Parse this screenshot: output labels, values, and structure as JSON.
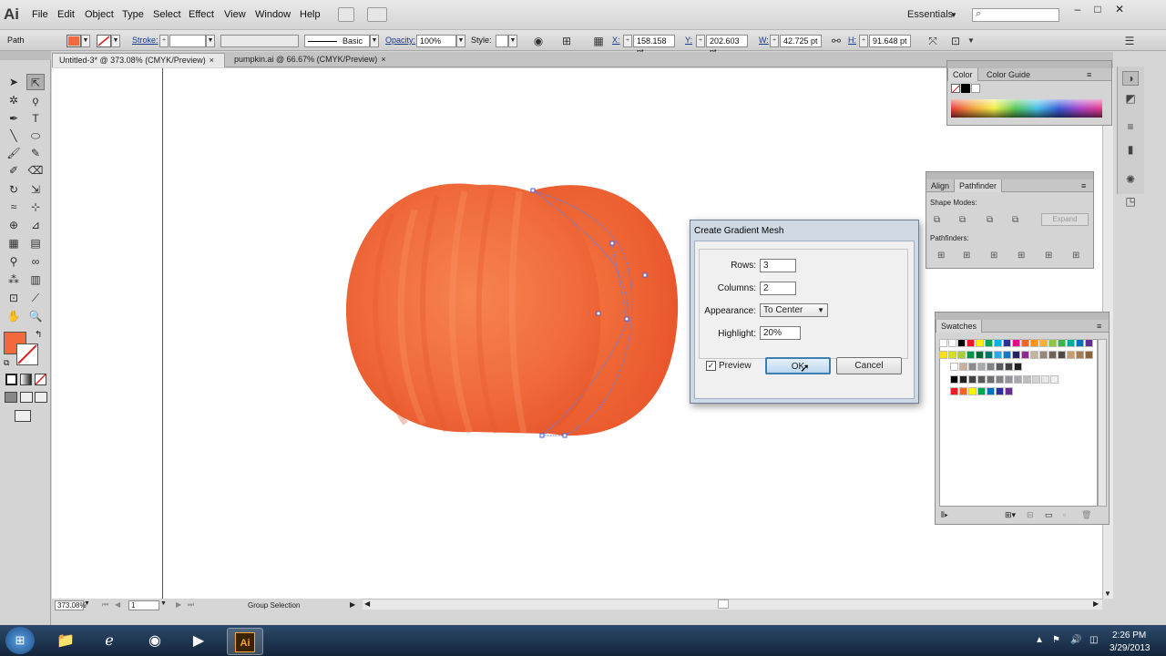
{
  "app": {
    "logo": "Ai"
  },
  "menu": [
    "File",
    "Edit",
    "Object",
    "Type",
    "Select",
    "Effect",
    "View",
    "Window",
    "Help"
  ],
  "workspace": "Essentials",
  "search_placeholder": "",
  "control_bar": {
    "selection_label": "Path",
    "stroke_label": "Stroke:",
    "brush_label": "Basic",
    "opacity_label": "Opacity:",
    "opacity_value": "100%",
    "style_label": "Style:",
    "x_label": "X:",
    "x_value": "158.158 pt",
    "y_label": "Y:",
    "y_value": "202.603 pt",
    "w_label": "W:",
    "w_value": "42.725 pt",
    "h_label": "H:",
    "h_value": "91.648 pt",
    "fill_color": "#f26a3b"
  },
  "tabs": [
    {
      "label": "Untitled-3* @ 373.08% (CMYK/Preview)",
      "close": "×"
    },
    {
      "label": "pumpkin.ai @ 66.67% (CMYK/Preview)",
      "close": "×"
    }
  ],
  "status": {
    "zoom": "373.08%",
    "page": "1",
    "tool": "Group Selection"
  },
  "color_panel": {
    "tabs": [
      "Color",
      "Color Guide"
    ]
  },
  "pathfinder_panel": {
    "tabs": [
      "Align",
      "Pathfinder"
    ],
    "shape_modes": "Shape Modes:",
    "pathfinders": "Pathfinders:",
    "expand": "Expand"
  },
  "swatches_panel": {
    "title": "Swatches"
  },
  "dialog": {
    "title": "Create Gradient Mesh",
    "rows_label": "Rows:",
    "rows_value": "3",
    "columns_label": "Columns:",
    "columns_value": "2",
    "appearance_label": "Appearance:",
    "appearance_value": "To Center",
    "highlight_label": "Highlight:",
    "highlight_value": "20%",
    "preview_label": "Preview",
    "ok_label": "OK",
    "cancel_label": "Cancel"
  },
  "taskbar": {
    "time": "2:26 PM",
    "date": "3/29/2013",
    "active_app": "Ai"
  },
  "colors": {
    "pumpkin": "#f26a3b",
    "pumpkin_dark": "#e9582c",
    "dialog_frame": "#cfd9e4"
  }
}
